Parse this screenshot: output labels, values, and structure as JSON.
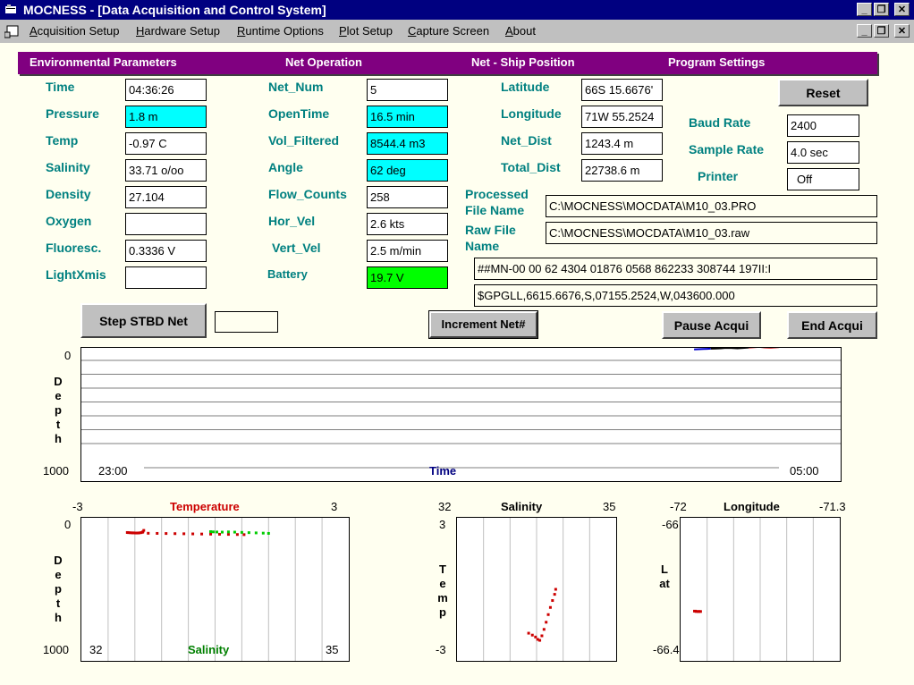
{
  "window": {
    "title": "MOCNESS - [Data Acquisition and Control System]"
  },
  "menu": {
    "items": [
      {
        "label": "Acquisition Setup"
      },
      {
        "label": "Hardware Setup"
      },
      {
        "label": "Runtime Options"
      },
      {
        "label": "Plot Setup"
      },
      {
        "label": "Capture Screen"
      },
      {
        "label": "About"
      }
    ]
  },
  "sections": {
    "environmental": "Environmental Parameters",
    "net_operation": "Net Operation",
    "net_ship": "Net - Ship Position",
    "program_settings": "Program Settings"
  },
  "environmental": {
    "time": {
      "label": "Time",
      "value": "04:36:26"
    },
    "pressure": {
      "label": "Pressure",
      "value": "1.8 m"
    },
    "temp": {
      "label": "Temp",
      "value": "-0.97 C"
    },
    "salinity": {
      "label": "Salinity",
      "value": "33.71 o/oo"
    },
    "density": {
      "label": "Density",
      "value": "27.104"
    },
    "oxygen": {
      "label": "Oxygen",
      "value": ""
    },
    "fluoresc": {
      "label": "Fluoresc.",
      "value": "0.3336 V"
    },
    "lightxmis": {
      "label": "LightXmis",
      "value": ""
    }
  },
  "net_operation": {
    "net_num": {
      "label": "Net_Num",
      "value": "5"
    },
    "opentime": {
      "label": "OpenTime",
      "value": "16.5 min"
    },
    "vol_filtered": {
      "label": "Vol_Filtered",
      "value": "8544.4 m3"
    },
    "angle": {
      "label": "Angle",
      "value": "62 deg"
    },
    "flow_counts": {
      "label": "Flow_Counts",
      "value": "258"
    },
    "hor_vel": {
      "label": "Hor_Vel",
      "value": "2.6 kts"
    },
    "vert_vel": {
      "label": "Vert_Vel",
      "value": "2.5 m/min"
    },
    "battery": {
      "label": "Battery",
      "value": "19.7 V"
    }
  },
  "position": {
    "latitude": {
      "label": "Latitude",
      "value": "66S 15.6676'"
    },
    "longitude": {
      "label": "Longitude",
      "value": "71W 55.2524"
    },
    "net_dist": {
      "label": "Net_Dist",
      "value": "1243.4 m"
    },
    "total_dist": {
      "label": "Total_Dist",
      "value": "22738.6 m"
    }
  },
  "settings": {
    "reset_label": "Reset",
    "baud_rate": {
      "label": "Baud Rate",
      "value": "2400"
    },
    "sample_rate": {
      "label": "Sample Rate",
      "value": "4.0 sec"
    },
    "printer": {
      "label": "Printer",
      "value": "Off"
    }
  },
  "files": {
    "processed_label_1": "Processed",
    "processed_label_2": "File Name",
    "processed_value": "C:\\MOCNESS\\MOCDATA\\M10_03.PRO",
    "raw_label_1": "Raw File",
    "raw_label_2": "Name",
    "raw_value": "C:\\MOCNESS\\MOCDATA\\M10_03.raw"
  },
  "data_strings": {
    "mn": "##MN-00 00 62 4304 01876 0568 862233 308744 197II:I",
    "gpgll": "$GPGLL,6615.6676,S,07155.2524,W,043600.000"
  },
  "buttons": {
    "step_stbd": "Step STBD Net",
    "step_stbd_value": "",
    "increment": "Increment Net#",
    "pause": "Pause Acqui",
    "end": "End Acqui"
  },
  "colors": {
    "title_bg": "#000080",
    "section_bg": "#800080",
    "label_teal": "#008080",
    "highlight_cyan": "#00ffff",
    "highlight_green": "#00ff00",
    "temp_red": "#cc0000",
    "salinity_green": "#00cc00",
    "time_blue": "#000080"
  },
  "chart_data": [
    {
      "type": "line",
      "name": "depth-time",
      "xlabel": "Time",
      "ylabel": "Depth",
      "y_top": "0",
      "y_bottom": "1000",
      "ylim": [
        1000,
        0
      ],
      "x_start": "23:00",
      "x_end": "05:00",
      "series": [
        {
          "color": "#0000cc",
          "points": [
            [
              0.807,
              14
            ],
            [
              0.813,
              12
            ],
            [
              0.819,
              10
            ],
            [
              0.824,
              9
            ],
            [
              0.829,
              7
            ]
          ]
        },
        {
          "color": "#000000",
          "points": [
            [
              0.829,
              7
            ],
            [
              0.835,
              6
            ],
            [
              0.842,
              4
            ],
            [
              0.849,
              0
            ],
            [
              0.856,
              1
            ],
            [
              0.864,
              4
            ],
            [
              0.871,
              1
            ],
            [
              0.879,
              -3
            ]
          ]
        },
        {
          "color": "#cc0000",
          "points": [
            [
              0.879,
              -3
            ],
            [
              0.886,
              -6
            ],
            [
              0.893,
              -9
            ],
            [
              0.9,
              -4
            ],
            [
              0.908,
              -2
            ],
            [
              0.915,
              -5
            ],
            [
              0.919,
              -7
            ]
          ]
        }
      ]
    },
    {
      "type": "scatter",
      "name": "depth-temperature-salinity",
      "title": "Temperature",
      "xlabel": "Salinity",
      "ylabel": "Depth",
      "temp_xlim": [
        -3,
        3
      ],
      "sal_xlim": [
        32,
        35
      ],
      "ylim": [
        1000,
        0
      ],
      "temp_min_label": "-3",
      "temp_max_label": "3",
      "sal_min_label": "32",
      "sal_max_label": "35",
      "y_top": "0",
      "y_bottom": "1000",
      "temperature": [
        [
          -1.97,
          7
        ],
        [
          -1.94,
          8
        ],
        [
          -1.9,
          9
        ],
        [
          -1.86,
          10
        ],
        [
          -1.83,
          10
        ],
        [
          -1.79,
          11
        ],
        [
          -1.76,
          11
        ],
        [
          -1.73,
          11
        ],
        [
          -1.7,
          10
        ],
        [
          -1.66,
          8
        ],
        [
          -1.63,
          5
        ],
        [
          -1.62,
          2
        ],
        [
          -1.6,
          -10
        ],
        [
          -1.5,
          13
        ],
        [
          -1.3,
          14
        ],
        [
          -1.1,
          15
        ],
        [
          -0.9,
          16
        ],
        [
          -0.7,
          17
        ],
        [
          -0.5,
          18
        ],
        [
          -0.3,
          19
        ],
        [
          -0.1,
          20
        ],
        [
          0.1,
          21
        ],
        [
          0.3,
          22
        ],
        [
          0.5,
          23
        ],
        [
          0.65,
          24
        ]
      ],
      "salinity": [
        [
          33.45,
          0
        ],
        [
          33.48,
          2
        ],
        [
          33.52,
          3
        ],
        [
          33.58,
          4
        ],
        [
          33.65,
          2
        ],
        [
          33.72,
          4
        ],
        [
          33.8,
          6
        ],
        [
          33.88,
          8
        ],
        [
          33.96,
          10
        ],
        [
          34.04,
          12
        ],
        [
          34.1,
          14
        ]
      ]
    },
    {
      "type": "scatter",
      "name": "temp-salinity",
      "title": "Salinity",
      "ylabel": "Temp",
      "xlim": [
        32,
        35
      ],
      "ylim": [
        -3,
        3
      ],
      "x_min_label": "32",
      "x_max_label": "35",
      "y_top": "3",
      "y_bottom": "-3",
      "points": [
        [
          33.35,
          -1.84
        ],
        [
          33.42,
          -1.92
        ],
        [
          33.48,
          -2.0
        ],
        [
          33.52,
          -2.1
        ],
        [
          33.56,
          -2.14
        ],
        [
          33.6,
          -1.95
        ],
        [
          33.64,
          -1.68
        ],
        [
          33.68,
          -1.38
        ],
        [
          33.72,
          -1.06
        ],
        [
          33.76,
          -0.76
        ],
        [
          33.8,
          -0.47
        ],
        [
          33.84,
          -0.21
        ],
        [
          33.86,
          0.0
        ]
      ]
    },
    {
      "type": "scatter",
      "name": "lat-lon",
      "title": "Longitude",
      "ylabel": "Lat",
      "xlim": [
        -72,
        -71.3
      ],
      "ylim": [
        -66.4,
        -66
      ],
      "x_min_label": "-72",
      "x_max_label": "-71.3",
      "y_top": "-66",
      "y_bottom": "-66.4",
      "points": [
        [
          -71.937,
          -66.261
        ],
        [
          -71.93,
          -66.262
        ],
        [
          -71.921,
          -66.262
        ],
        [
          -71.914,
          -66.262
        ]
      ]
    }
  ]
}
